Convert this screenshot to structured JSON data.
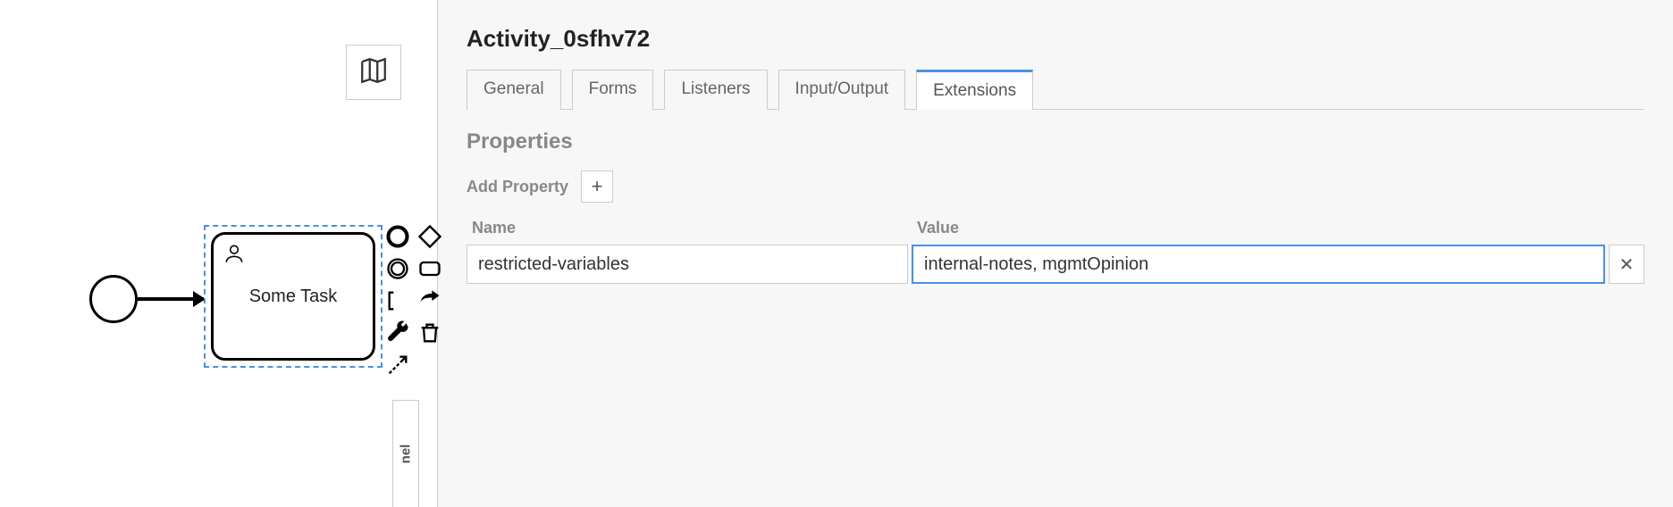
{
  "canvas": {
    "task_label": "Some Task",
    "collapse_label": "nel"
  },
  "panel": {
    "title": "Activity_0sfhv72",
    "tabs": [
      {
        "label": "General",
        "active": false
      },
      {
        "label": "Forms",
        "active": false
      },
      {
        "label": "Listeners",
        "active": false
      },
      {
        "label": "Input/Output",
        "active": false
      },
      {
        "label": "Extensions",
        "active": true
      }
    ],
    "section_title": "Properties",
    "add_label": "Add Property",
    "columns": {
      "name": "Name",
      "value": "Value"
    },
    "rows": [
      {
        "name": "restricted-variables",
        "value": "internal-notes, mgmtOpinion"
      }
    ]
  }
}
